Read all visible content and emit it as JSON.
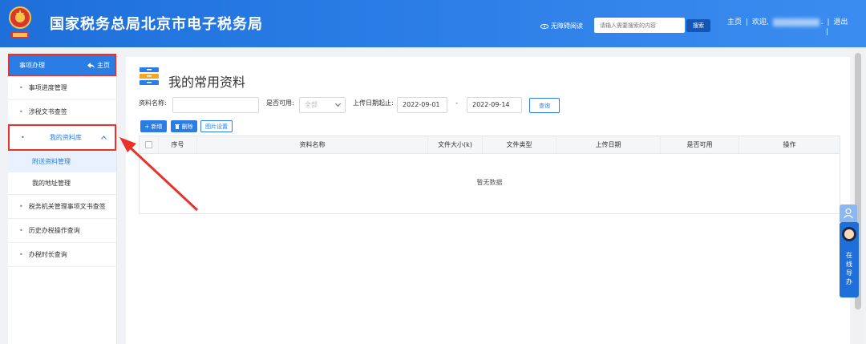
{
  "header": {
    "title": "国家税务总局北京市电子税务局",
    "accessibility": "无障碍阅读",
    "search_placeholder": "请输入需要搜索的内容",
    "search_button": "搜索",
    "home_link": "主页",
    "separator": "|",
    "welcome": "欢迎,",
    "user_suffix": ".",
    "logout": "退出",
    "colors": {
      "brand": "#2b7de6",
      "annotation_red": "#e8322b"
    }
  },
  "sidebar": {
    "head_label": "事项办理",
    "head_home": "主页",
    "items": [
      {
        "label": "事项进度管理"
      },
      {
        "label": "涉税文书查签"
      },
      {
        "label": "我的资料库"
      },
      {
        "label": "税务机关管理事项文书查签"
      },
      {
        "label": "历史办税操作查询"
      },
      {
        "label": "办税时长查询"
      }
    ],
    "sub_items": [
      {
        "label": "附送资料管理"
      },
      {
        "label": "我的地址管理"
      }
    ]
  },
  "main": {
    "title": "我的常用资料",
    "filters": {
      "name_label": "资料名称:",
      "available_label": "是否可用:",
      "available_value": "全部",
      "date_label": "上传日期起止:",
      "date_from": "2022-09-01",
      "date_sep": "-",
      "date_to": "2022-09-14",
      "query_button": "查询"
    },
    "toolbar": {
      "add": "+ 新增",
      "delete": "删除",
      "image_settings": "图片设置"
    },
    "table": {
      "columns": [
        "序号",
        "资料名称",
        "文件大小(k)",
        "文件类型",
        "上传日期",
        "是否可用",
        "操作"
      ],
      "empty_text": "暂无数据"
    }
  },
  "helper": {
    "text": "在线导办"
  }
}
